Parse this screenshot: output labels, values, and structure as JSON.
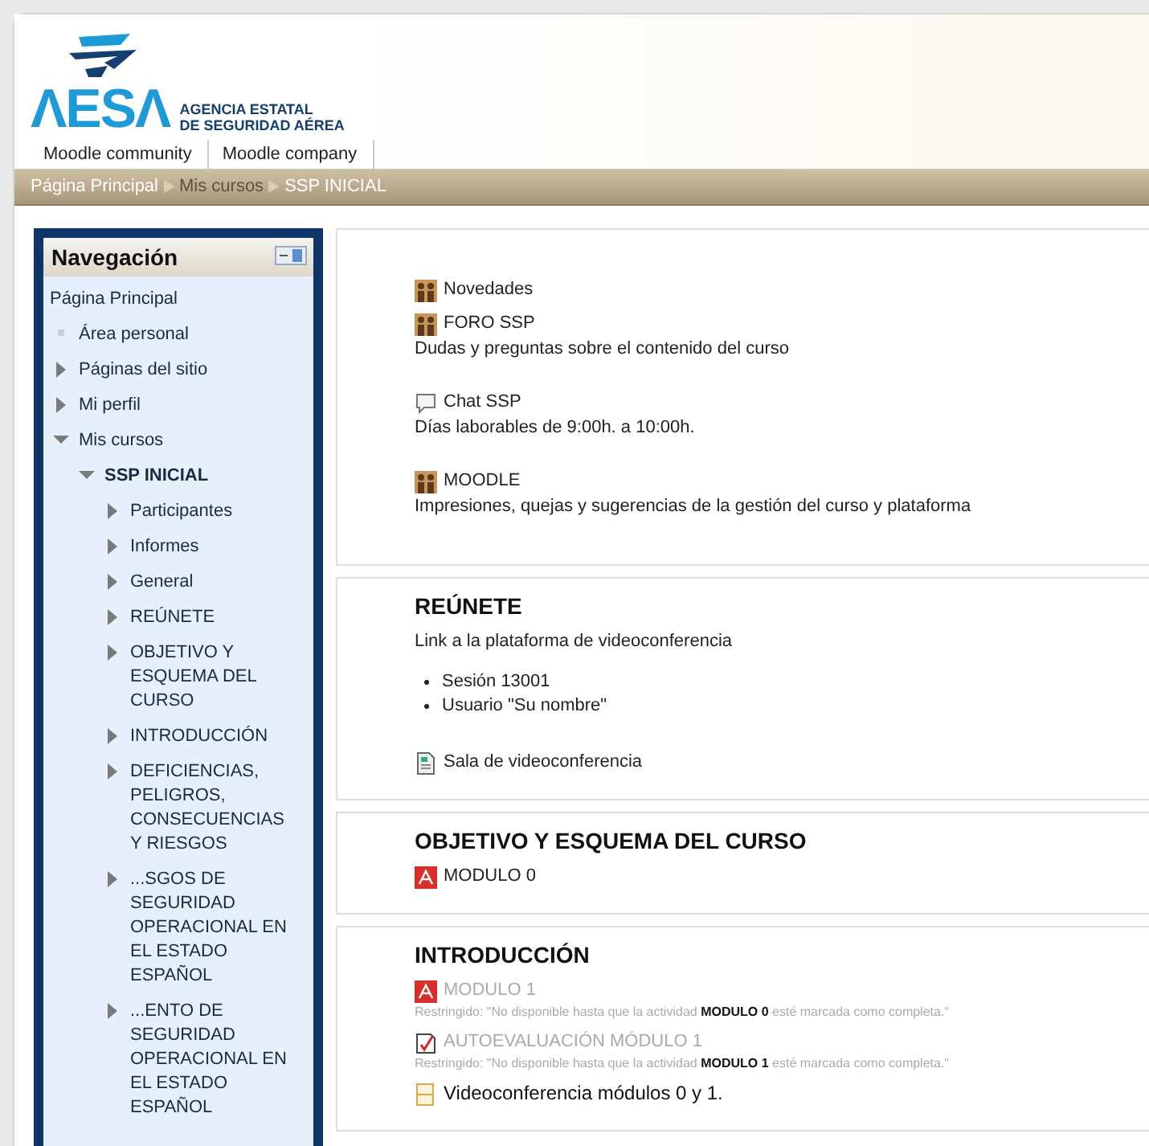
{
  "logo": {
    "mark": "ΛESΛ",
    "agency_line_1": "AGENCIA ESTATAL",
    "agency_line_2": "DE SEGURIDAD AÉREA"
  },
  "custom_menu": [
    "Moodle community",
    "Moodle company"
  ],
  "breadcrumb": [
    {
      "label": "Página Principal",
      "dimmed": false
    },
    {
      "label": "Mis cursos",
      "dimmed": true
    },
    {
      "label": "SSP INICIAL",
      "dimmed": false
    }
  ],
  "navigation": {
    "title": "Navegación",
    "items": [
      {
        "label": "Página Principal",
        "kind": "root"
      },
      {
        "label": "Área personal",
        "kind": "leaf"
      },
      {
        "label": "Páginas del sitio",
        "kind": "branch",
        "expanded": false
      },
      {
        "label": "Mi perfil",
        "kind": "branch",
        "expanded": false
      },
      {
        "label": "Mis cursos",
        "kind": "branch",
        "expanded": true,
        "children": [
          {
            "label": "SSP INICIAL",
            "kind": "course",
            "expanded": true,
            "children": [
              {
                "label": "Participantes",
                "kind": "branch",
                "expanded": false
              },
              {
                "label": "Informes",
                "kind": "branch",
                "expanded": false
              },
              {
                "label": "General",
                "kind": "branch",
                "expanded": false
              },
              {
                "label": "REÚNETE",
                "kind": "branch",
                "expanded": false
              },
              {
                "label": "OBJETIVO Y ESQUEMA DEL CURSO",
                "kind": "branch",
                "expanded": false
              },
              {
                "label": "INTRODUCCIÓN",
                "kind": "branch",
                "expanded": false
              },
              {
                "label": "DEFICIENCIAS, PELIGROS, CONSECUENCIAS Y RIESGOS",
                "kind": "branch",
                "expanded": false
              },
              {
                "label": "...SGOS DE SEGURIDAD OPERACIONAL EN EL ESTADO ESPAÑOL",
                "kind": "branch",
                "expanded": false
              },
              {
                "label": "...ENTO DE SEGURIDAD OPERACIONAL EN EL ESTADO ESPAÑOL",
                "kind": "branch",
                "expanded": false
              }
            ]
          }
        ]
      }
    ]
  },
  "sections": [
    {
      "activities": [
        {
          "kind": "forum",
          "name": "Novedades",
          "disabled": false
        },
        {
          "kind": "forum",
          "name": "FORO SSP",
          "description": "Dudas y preguntas sobre el contenido del curso",
          "disabled": false
        },
        {
          "kind": "chat",
          "name": "Chat SSP",
          "description": "Días laborables de 9:00h. a 10:00h.",
          "disabled": false
        },
        {
          "kind": "forum",
          "name": "MOODLE",
          "description": "Impresiones, quejas y sugerencias de la gestión del curso y plataforma",
          "disabled": false
        }
      ]
    },
    {
      "title": "REÚNETE",
      "summary": "Link a la plataforma de videoconferencia",
      "bullets": [
        "Sesión 13001",
        "Usuario  \"Su nombre\""
      ],
      "activities": [
        {
          "kind": "page",
          "name": "Sala de videoconferencia",
          "disabled": false
        }
      ]
    },
    {
      "title": "OBJETIVO Y ESQUEMA DEL CURSO",
      "activities": [
        {
          "kind": "pdf",
          "name": "MODULO 0",
          "disabled": false
        }
      ]
    },
    {
      "title": "INTRODUCCIÓN",
      "activities": [
        {
          "kind": "pdf",
          "name": "MODULO 1",
          "disabled": true,
          "restriction": "Restringido: \"No disponible hasta que la actividad **MODULO 0** esté marcada como completa.\""
        },
        {
          "kind": "quiz",
          "name": "AUTOEVALUACIÓN MÓDULO 1",
          "disabled": true,
          "restriction": "Restringido: \"No disponible hasta que la actividad **MODULO 1** esté marcada como completa.\""
        },
        {
          "kind": "label",
          "name": "Videoconferencia módulos 0 y 1.",
          "disabled": false
        }
      ]
    }
  ]
}
